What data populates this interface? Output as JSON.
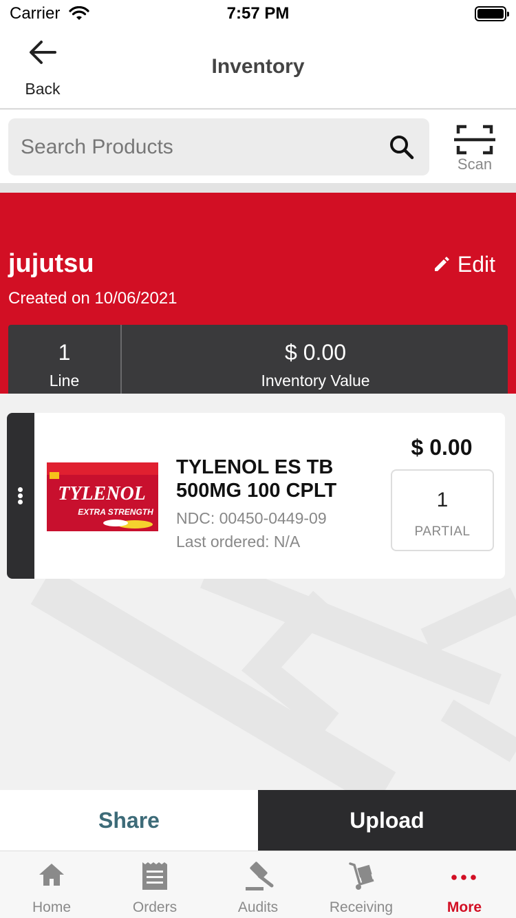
{
  "status_bar": {
    "carrier": "Carrier",
    "time": "7:57 PM"
  },
  "nav": {
    "back_label": "Back",
    "title": "Inventory"
  },
  "search": {
    "placeholder": "Search Products",
    "scan_label": "Scan"
  },
  "inventory": {
    "name": "jujutsu",
    "created": "Created on 10/06/2021",
    "edit_label": "Edit",
    "lines_value": "1",
    "lines_label": "Line",
    "value": "$ 0.00",
    "value_label": "Inventory Value"
  },
  "product": {
    "name": "TYLENOL ES TB 500MG 100 CPLT",
    "ndc": "NDC: 00450-0449-09",
    "last_ordered": "Last ordered: N/A",
    "price": "$ 0.00",
    "quantity": "1",
    "quantity_unit": "PARTIAL",
    "image_brand": "TYLENOL",
    "image_subtitle": "EXTRA STRENGTH"
  },
  "actions": {
    "share": "Share",
    "upload": "Upload"
  },
  "tabs": [
    {
      "label": "Home",
      "icon": "home-icon"
    },
    {
      "label": "Orders",
      "icon": "receipt-icon"
    },
    {
      "label": "Audits",
      "icon": "gavel-icon"
    },
    {
      "label": "Receiving",
      "icon": "hand-truck-icon"
    },
    {
      "label": "More",
      "icon": "more-dots-icon",
      "active": true
    }
  ],
  "colors": {
    "brand_red": "#d20f24",
    "dark": "#2b2b2d",
    "share_text": "#3d6b78"
  }
}
